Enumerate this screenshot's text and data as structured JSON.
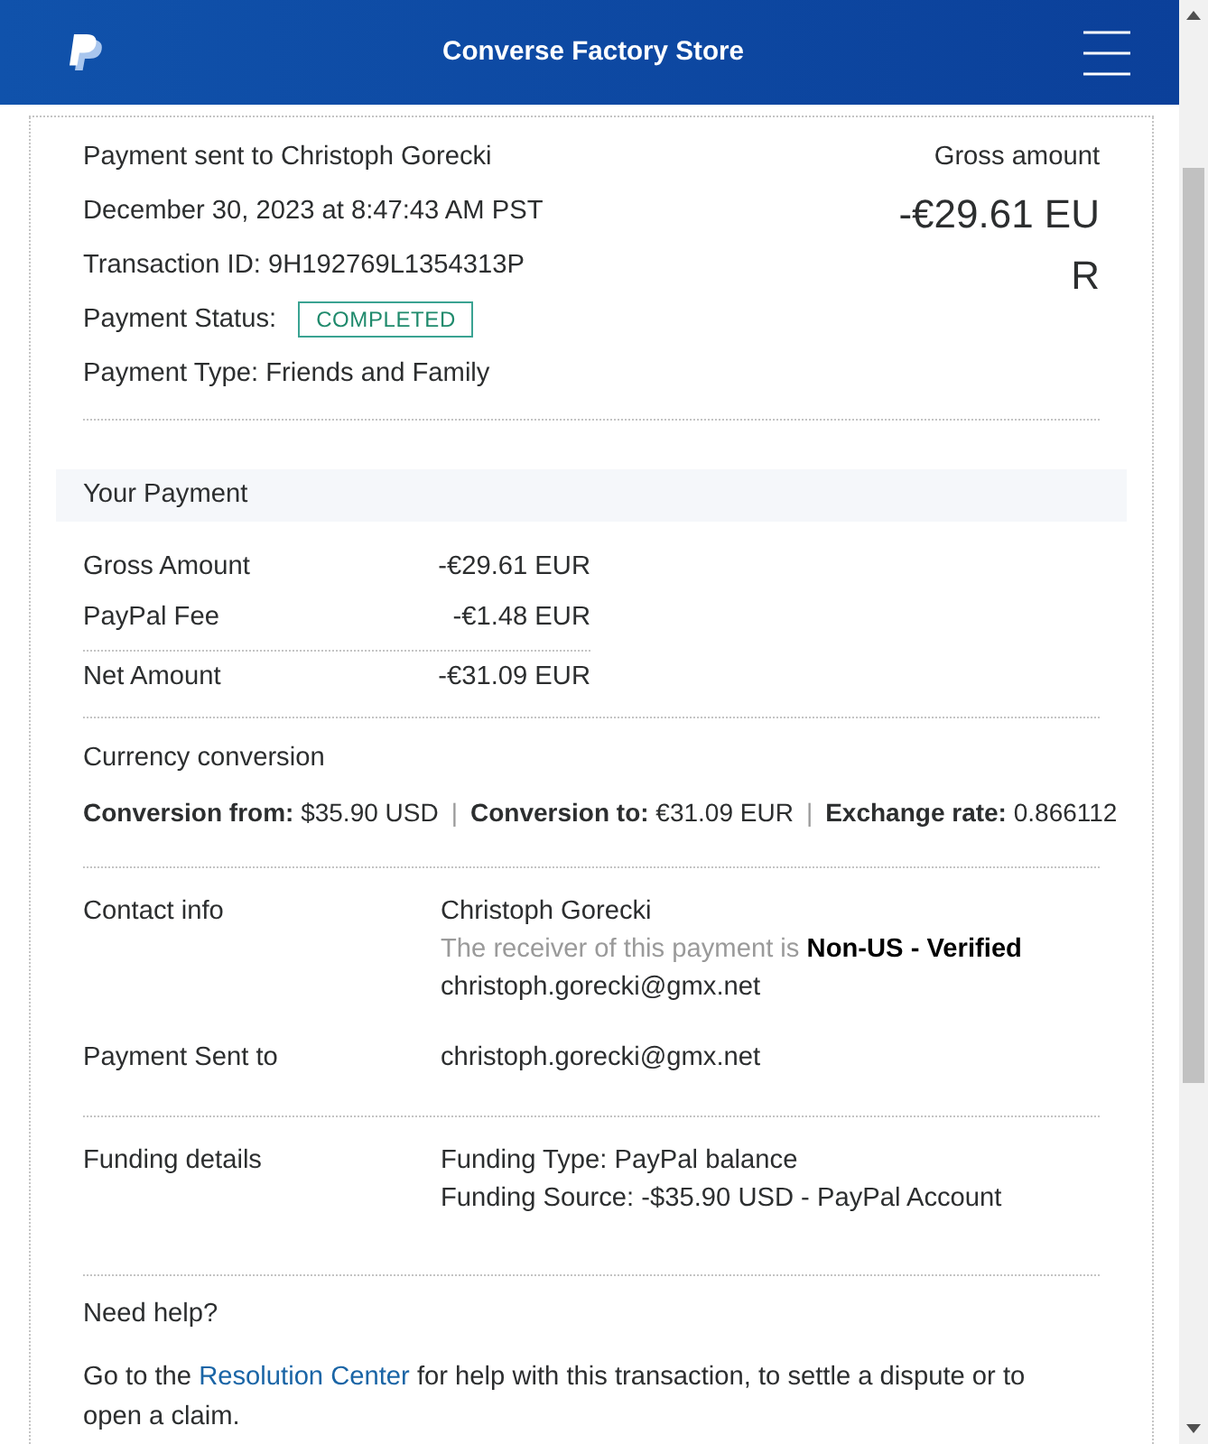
{
  "header": {
    "title": "Converse Factory Store"
  },
  "summary": {
    "heading": "Payment sent to Christoph Gorecki",
    "date": "December 30, 2023 at 8:47:43 AM PST",
    "transaction_id": "Transaction ID: 9H192769L1354313P",
    "status_label": "Payment Status:",
    "status": "COMPLETED",
    "payment_type": "Payment Type: Friends and Family",
    "gross_label": "Gross amount",
    "gross_amount": "-€29.61 EUR"
  },
  "your_payment": {
    "title": "Your Payment",
    "rows": [
      {
        "label": "Gross Amount",
        "value": "-€29.61 EUR"
      },
      {
        "label": "PayPal Fee",
        "value": "-€1.48 EUR"
      },
      {
        "label": "Net Amount",
        "value": "-€31.09 EUR"
      }
    ]
  },
  "currency_conversion": {
    "title": "Currency conversion",
    "items": [
      {
        "kind": "pair",
        "label": "Conversion from:",
        "value": "$35.90 USD"
      },
      {
        "kind": "separator",
        "text": "|"
      },
      {
        "kind": "pair",
        "label": "Conversion to:",
        "value": "€31.09 EUR"
      },
      {
        "kind": "separator",
        "text": "|"
      },
      {
        "kind": "pair",
        "label": "Exchange rate:",
        "value": "0.866112"
      }
    ]
  },
  "detail_groups": [
    {
      "rows": [
        {
          "label": "Contact info",
          "lines": [
            {
              "kind": "text",
              "text": "Christoph Gorecki"
            },
            {
              "kind": "note",
              "text": "The receiver of this payment is **Non-US - Verified**"
            },
            {
              "kind": "text",
              "text": "christoph.gorecki@gmx.net"
            }
          ]
        },
        {
          "label": "Payment Sent to",
          "lines": [
            {
              "kind": "text",
              "text": "christoph.gorecki@gmx.net"
            }
          ]
        }
      ]
    },
    {
      "rows": [
        {
          "label": "Funding details",
          "lines": [
            {
              "kind": "text",
              "text": "Funding Type: PayPal balance"
            },
            {
              "kind": "text",
              "text": "Funding Source: -$35.90 USD - PayPal Account"
            }
          ]
        }
      ]
    }
  ],
  "help": {
    "title": "Need help?",
    "text_before": "Go to the ",
    "link": "Resolution Center",
    "text_after": " for help with this transaction, to settle a dispute or to open a claim."
  }
}
